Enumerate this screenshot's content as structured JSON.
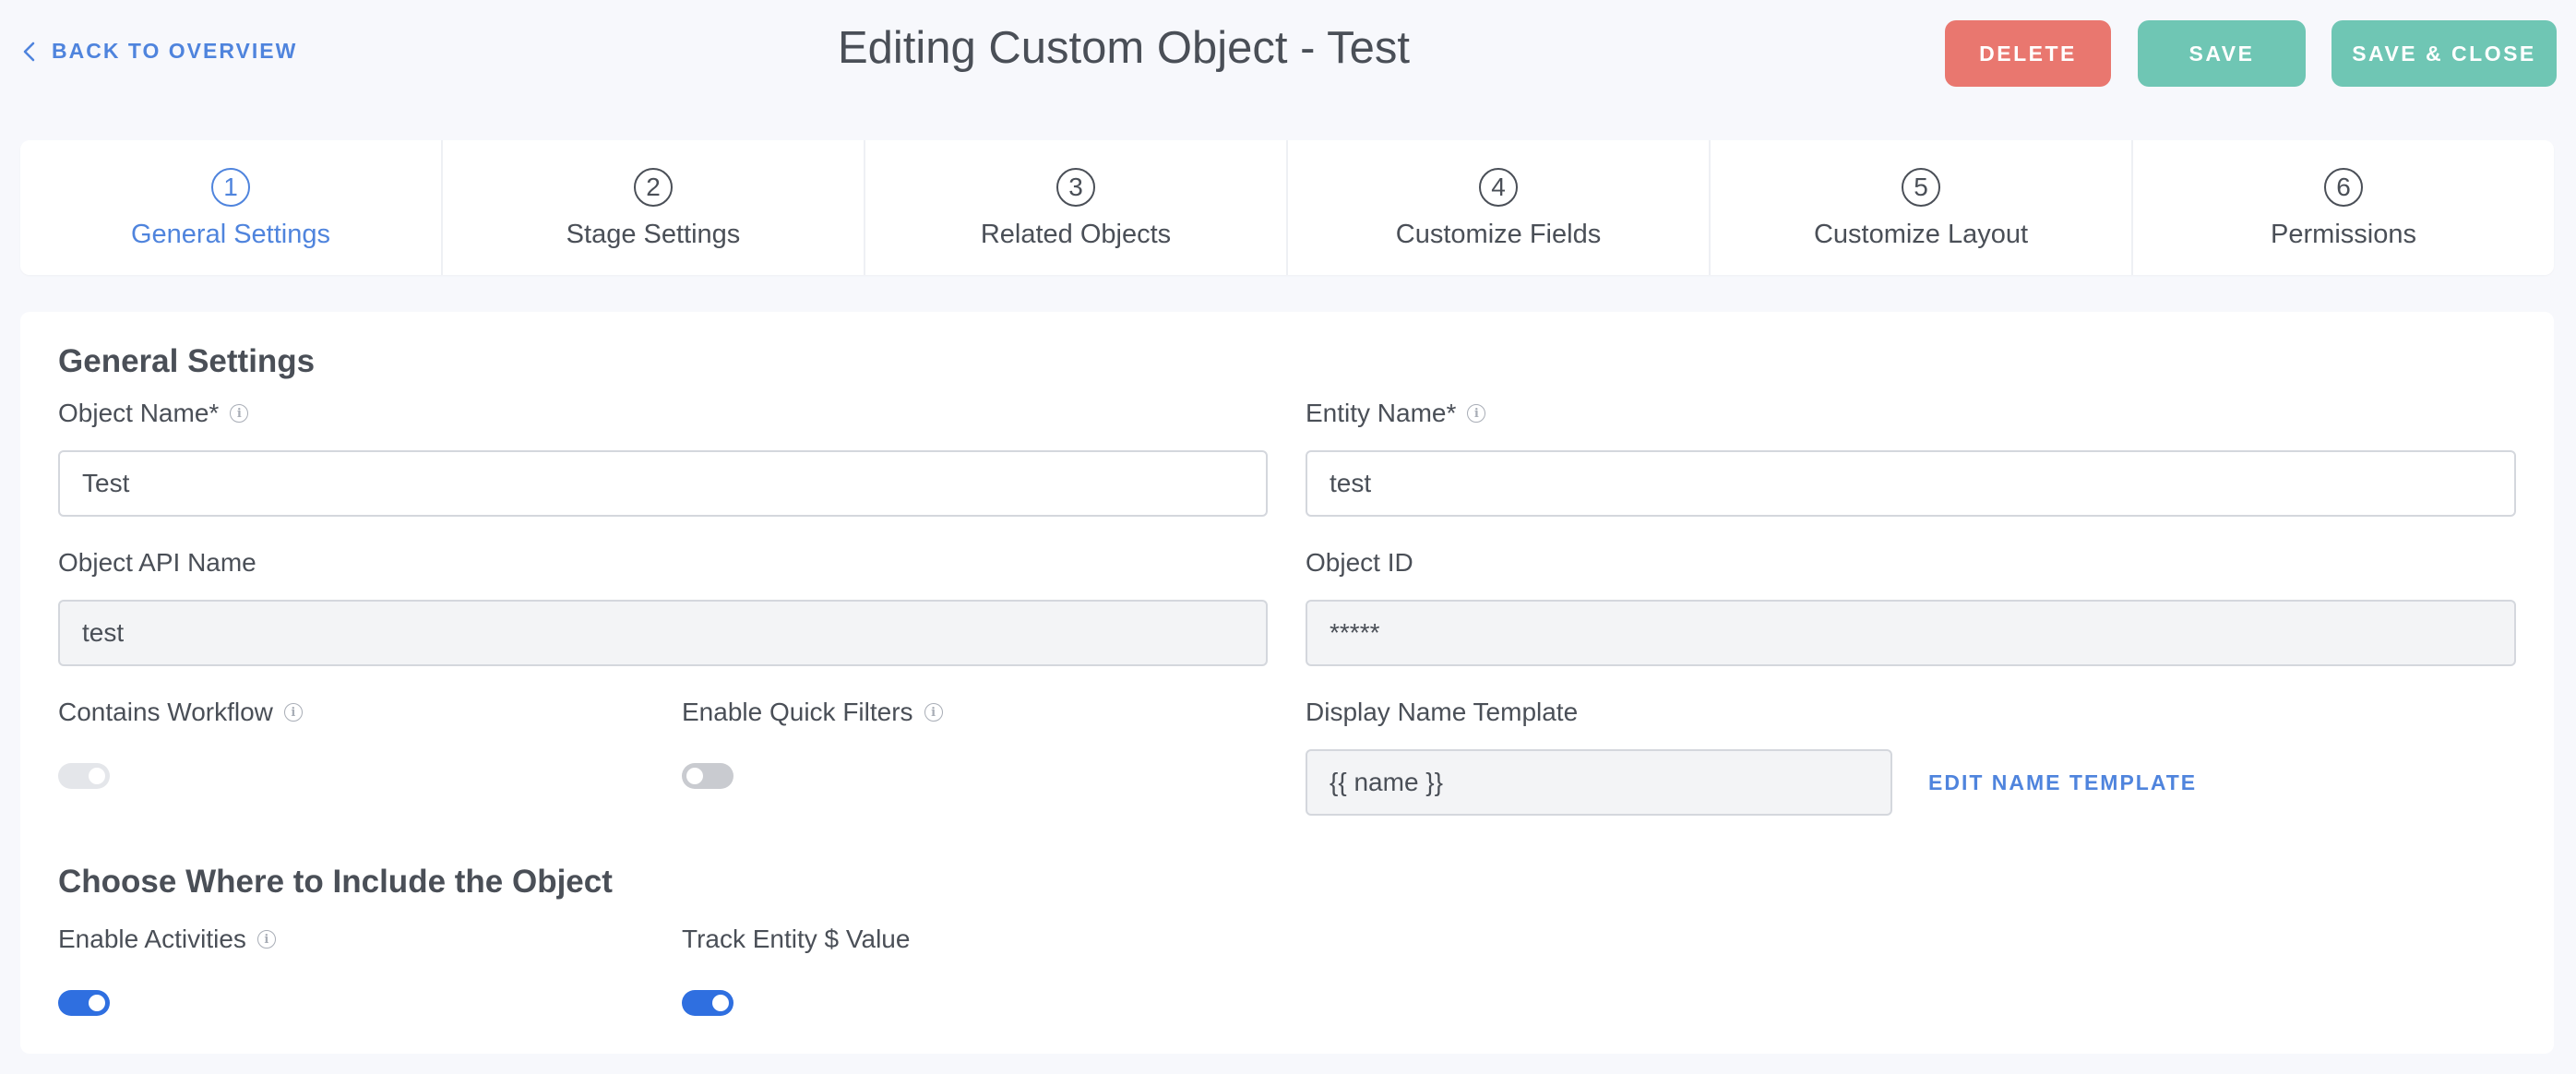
{
  "header": {
    "back_label": "BACK TO OVERVIEW",
    "title": "Editing Custom Object - Test",
    "delete_label": "DELETE",
    "save_label": "SAVE",
    "save_close_label": "SAVE & CLOSE"
  },
  "steps": [
    {
      "number": "1",
      "label": "General Settings",
      "active": true
    },
    {
      "number": "2",
      "label": "Stage Settings"
    },
    {
      "number": "3",
      "label": "Related Objects"
    },
    {
      "number": "4",
      "label": "Customize Fields"
    },
    {
      "number": "5",
      "label": "Customize Layout"
    },
    {
      "number": "6",
      "label": "Permissions"
    }
  ],
  "general": {
    "section_title": "General Settings",
    "object_name_label": "Object Name*",
    "object_name_value": "Test",
    "entity_name_label": "Entity Name*",
    "entity_name_value": "test",
    "api_name_label": "Object API Name",
    "api_name_value": "test",
    "object_id_label": "Object ID",
    "object_id_value": "*****",
    "contains_workflow_label": "Contains Workflow",
    "contains_workflow_state": "disabled",
    "quick_filters_label": "Enable Quick Filters",
    "quick_filters_state": "off",
    "display_template_label": "Display Name Template",
    "display_template_value": "{{ name }}",
    "edit_template_label": "EDIT NAME TEMPLATE"
  },
  "include": {
    "section_title": "Choose Where to Include the Object",
    "activities_label": "Enable Activities",
    "activities_state": "on",
    "track_value_label": "Track Entity $ Value",
    "track_value_state": "on"
  },
  "colors": {
    "accent": "#4f84dd",
    "delete": "#e9776f",
    "save": "#6fc6b4",
    "toggle_on": "#2f6fe0",
    "background": "#f7f8fc"
  },
  "icons": {
    "back": "chevron-left-icon",
    "info": "info-circle-icon"
  }
}
